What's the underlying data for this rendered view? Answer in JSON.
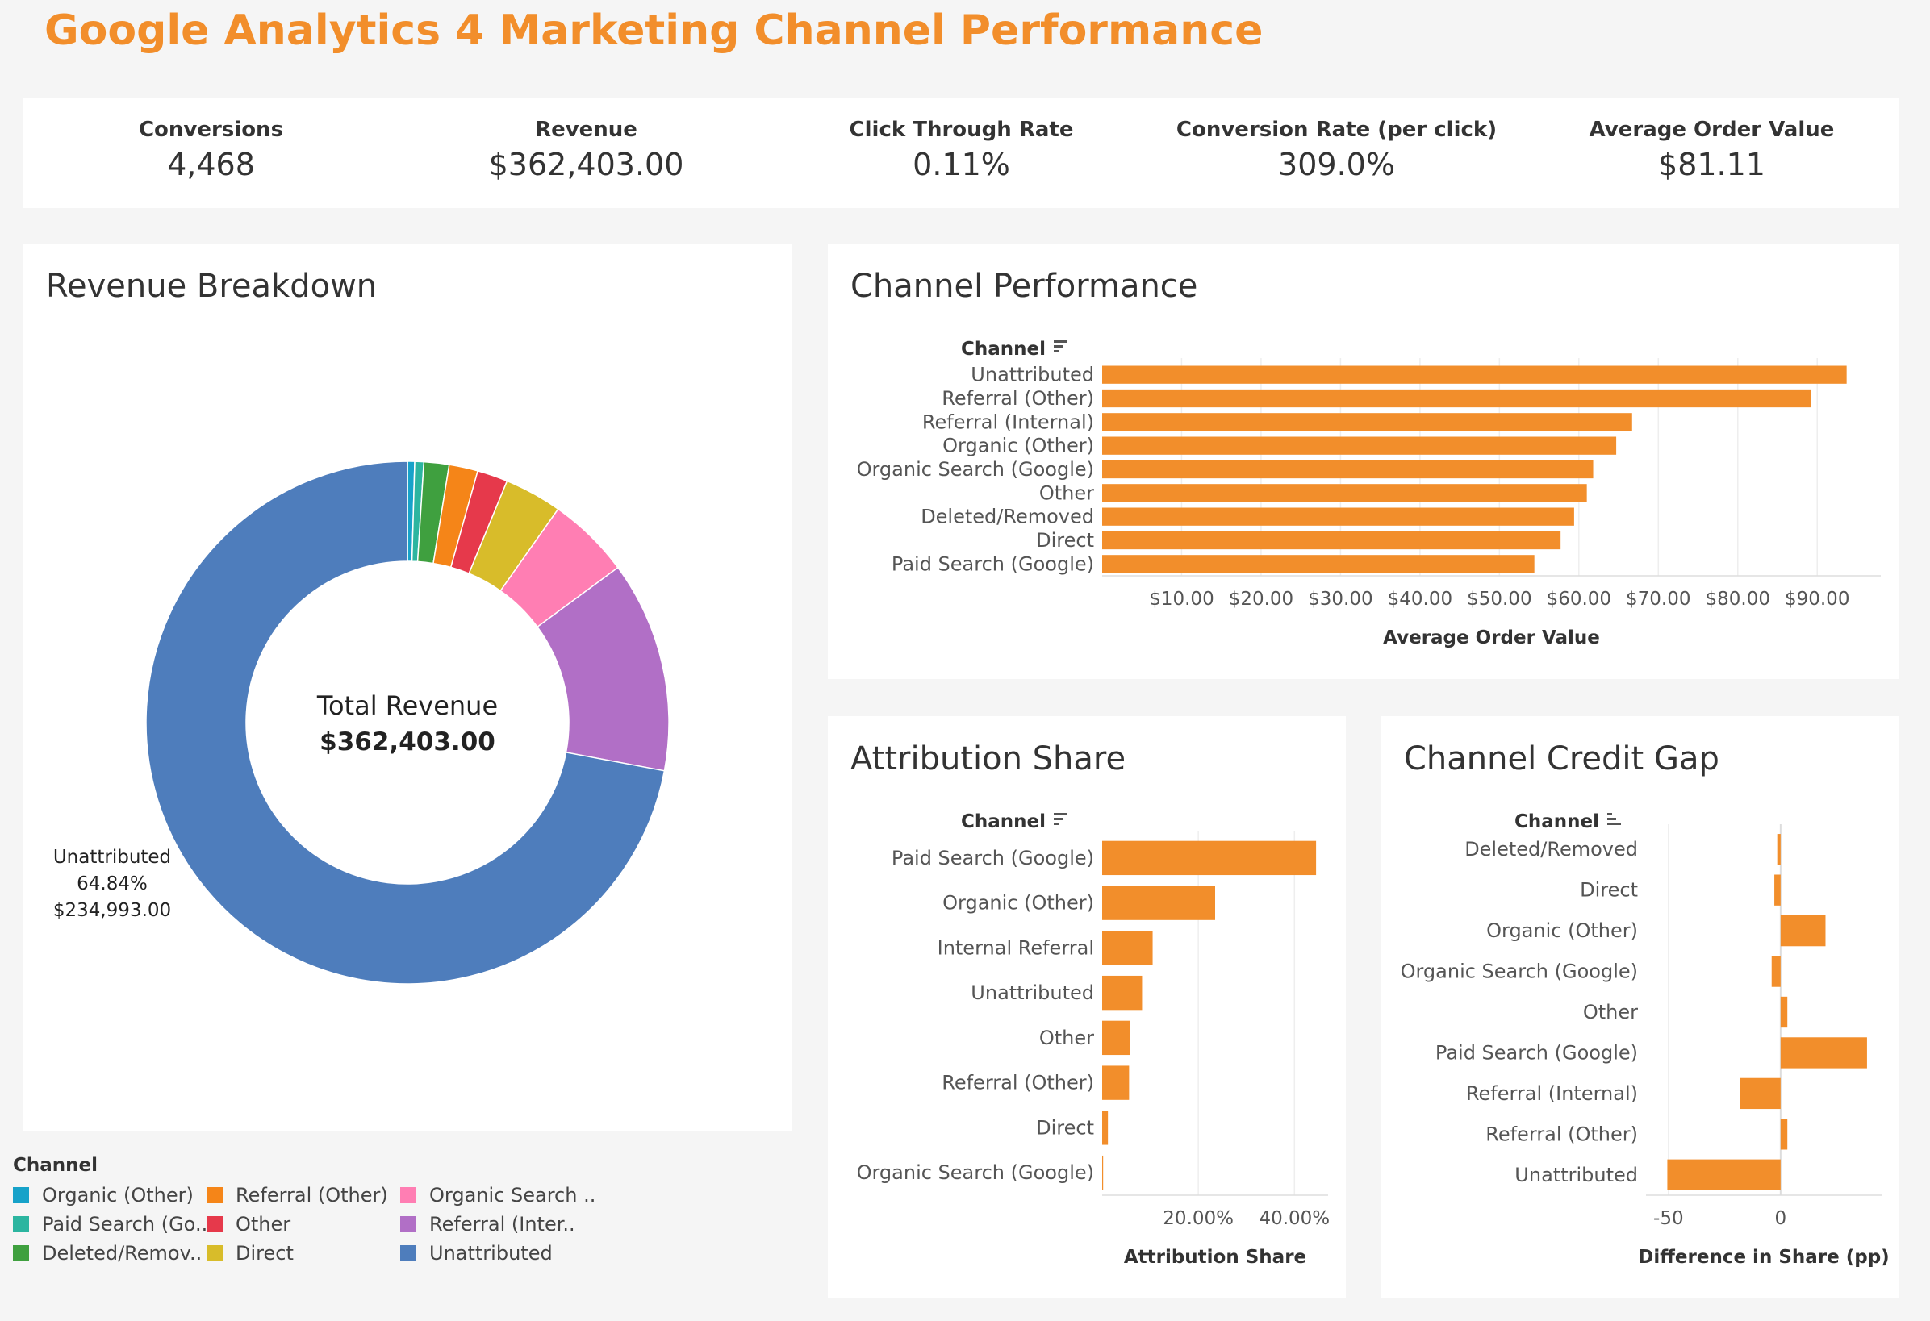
{
  "page": {
    "title": "Google Analytics 4 Marketing Channel Performance"
  },
  "kpis": [
    {
      "label": "Conversions",
      "value": "4,468"
    },
    {
      "label": "Revenue",
      "value": "$362,403.00"
    },
    {
      "label": "Click Through Rate",
      "value": "0.11%"
    },
    {
      "label": "Conversion Rate (per click)",
      "value": "309.0%"
    },
    {
      "label": "Average Order Value",
      "value": "$81.11"
    }
  ],
  "panels": {
    "revenue_breakdown": "Revenue Breakdown",
    "channel_performance": "Channel Performance",
    "attribution_share": "Attribution Share",
    "channel_credit_gap": "Channel Credit Gap"
  },
  "legend": {
    "title": "Channel",
    "items": [
      {
        "label": "Organic (Other)",
        "color": "#17a2c9"
      },
      {
        "label": "Referral (Other)",
        "color": "#f58518"
      },
      {
        "label": "Organic Search ..",
        "color": "#ff7eb3"
      },
      {
        "label": "Paid Search (Go..",
        "color": "#2cb5a0"
      },
      {
        "label": "Other",
        "color": "#e6394b"
      },
      {
        "label": "Referral (Inter..",
        "color": "#b16fc6"
      },
      {
        "label": "Deleted/Remov..",
        "color": "#3fa03f"
      },
      {
        "label": "Direct",
        "color": "#d8bc2a"
      },
      {
        "label": "Unattributed",
        "color": "#4e7dbc"
      }
    ]
  },
  "chart_data": [
    {
      "type": "pie",
      "title": "Revenue Breakdown",
      "center_label": "Total Revenue",
      "center_value": "$362,403.00",
      "slices": [
        {
          "name": "Organic (Other)",
          "share": 0.004,
          "color": "#17a2c9"
        },
        {
          "name": "Paid Search (Google)",
          "share": 0.005,
          "color": "#2cb5a0"
        },
        {
          "name": "Deleted/Removed",
          "share": 0.014,
          "color": "#3fa03f"
        },
        {
          "name": "Referral (Other)",
          "share": 0.016,
          "color": "#f58518"
        },
        {
          "name": "Other",
          "share": 0.017,
          "color": "#e6394b"
        },
        {
          "name": "Direct",
          "share": 0.032,
          "color": "#d8bc2a"
        },
        {
          "name": "Organic Search (Google)",
          "share": 0.046,
          "color": "#ff7eb3"
        },
        {
          "name": "Referral (Internal)",
          "share": 0.1176,
          "color": "#b16fc6"
        },
        {
          "name": "Unattributed",
          "share": 0.6484,
          "color": "#4e7dbc"
        }
      ],
      "annotation": {
        "name": "Unattributed",
        "percent": "64.84%",
        "value": "$234,993.00"
      }
    },
    {
      "type": "bar",
      "orientation": "horizontal",
      "title": "Channel Performance",
      "category_header": "Channel",
      "xlabel": "Average Order Value",
      "xlim": [
        0,
        98
      ],
      "ticks": [
        10,
        20,
        30,
        40,
        50,
        60,
        70,
        80,
        90
      ],
      "tick_labels": [
        "$10.00",
        "$20.00",
        "$30.00",
        "$40.00",
        "$50.00",
        "$60.00",
        "$70.00",
        "$80.00",
        "$90.00"
      ],
      "categories": [
        "Unattributed",
        "Referral (Other)",
        "Referral (Internal)",
        "Organic (Other)",
        "Organic Search (Google)",
        "Other",
        "Deleted/Removed",
        "Direct",
        "Paid Search (Google)"
      ],
      "values": [
        93.7,
        89.2,
        66.7,
        64.7,
        61.8,
        61.0,
        59.4,
        57.7,
        54.4
      ],
      "color": "#f28e2b"
    },
    {
      "type": "bar",
      "orientation": "horizontal",
      "title": "Attribution Share",
      "category_header": "Channel",
      "xlabel": "Attribution Share",
      "xlim": [
        0,
        47
      ],
      "ticks": [
        20,
        40
      ],
      "tick_labels": [
        "20.00%",
        "40.00%"
      ],
      "categories": [
        "Paid Search (Google)",
        "Organic (Other)",
        "Internal Referral",
        "Unattributed",
        "Other",
        "Referral (Other)",
        "Direct",
        "Organic Search (Google)"
      ],
      "values": [
        44.5,
        23.5,
        10.5,
        8.3,
        5.8,
        5.6,
        1.2,
        0.2
      ],
      "color": "#f28e2b"
    },
    {
      "type": "bar",
      "orientation": "horizontal",
      "title": "Channel Credit Gap",
      "category_header": "Channel",
      "xlabel": "Difference in Share (pp)",
      "xlim": [
        -60,
        45
      ],
      "ticks": [
        -50,
        0
      ],
      "tick_labels": [
        "-50",
        "0"
      ],
      "categories": [
        "Deleted/Removed",
        "Direct",
        "Organic (Other)",
        "Organic Search (Google)",
        "Other",
        "Paid Search (Google)",
        "Referral (Internal)",
        "Referral (Other)",
        "Unattributed"
      ],
      "values": [
        -1.5,
        -2.8,
        20.0,
        -4.0,
        3.0,
        38.5,
        -18.0,
        3.0,
        -50.5
      ],
      "color": "#f28e2b"
    }
  ]
}
